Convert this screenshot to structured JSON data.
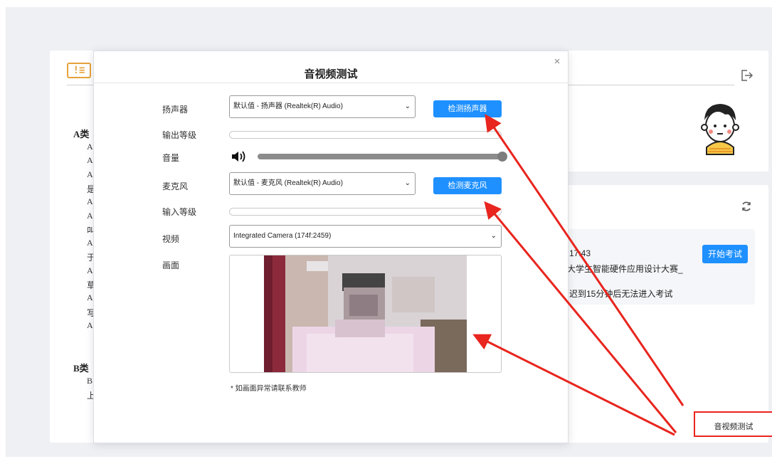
{
  "background": {
    "categories": [
      {
        "label": "A类",
        "items": [
          "A",
          "A",
          "A",
          "是",
          "A",
          "A",
          "叫",
          "A",
          "于",
          "A",
          "草",
          "A",
          "写",
          "A"
        ]
      },
      {
        "label": "B类",
        "items": [
          "B",
          "上"
        ]
      }
    ],
    "exam": {
      "line1": "17:43",
      "line2": "大学生智能硬件应用设计大赛_",
      "line3": "迟到15分钟后无法进入考试",
      "start_label": "开始考试"
    },
    "av_test_label": "音视频测试"
  },
  "dialog": {
    "title": "音视频测试",
    "close_glyph": "×",
    "speaker": {
      "label": "扬声器",
      "value": "默认值 - 扬声器 (Realtek(R) Audio)",
      "button": "检测扬声器"
    },
    "output_level": {
      "label": "输出等级",
      "level": 0
    },
    "volume": {
      "label": "音量",
      "level": 1.0
    },
    "mic": {
      "label": "麦克风",
      "value": "默认值 - 麦克风 (Realtek(R) Audio)",
      "button": "检测麦克风"
    },
    "input_level": {
      "label": "输入等级",
      "level": 0
    },
    "video": {
      "label": "视频",
      "value": "Integrated Camera (174f:2459)"
    },
    "preview": {
      "label": "画面"
    },
    "note": "* 如画面异常请联系教师"
  },
  "colors": {
    "primary": "#1e90ff",
    "annotation": "#e8251e",
    "warning": "#e6a23c"
  }
}
